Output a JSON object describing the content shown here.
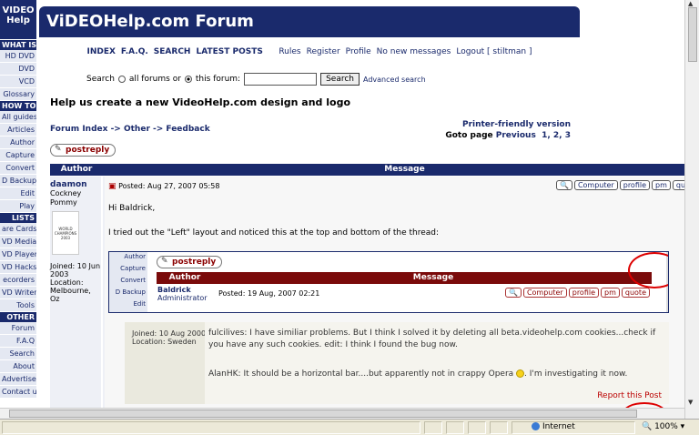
{
  "sidebar": {
    "logo": "VIDEO Help",
    "sections": [
      {
        "title": "WHAT IS",
        "items": [
          "HD DVD",
          "DVD",
          "VCD",
          "Glossary"
        ]
      },
      {
        "title": "HOW TO",
        "items": [
          "All guides",
          "Articles",
          "Author",
          "Capture",
          "Convert",
          "D Backup",
          "Edit",
          "Play"
        ]
      },
      {
        "title": "LISTS",
        "items": [
          "are Cards",
          "VD Media",
          "VD Players",
          "VD Hacks",
          "ecorders",
          "VD Writers",
          "Tools"
        ]
      },
      {
        "title": "OTHER",
        "items": [
          "Forum",
          "F.A.Q",
          "Search",
          "About",
          "Advertise",
          "Contact us"
        ]
      }
    ]
  },
  "header": {
    "title": "ViDEOHelp.com Forum"
  },
  "nav": {
    "primary": [
      "INDEX",
      "F.A.Q.",
      "SEARCH",
      "LATEST POSTS"
    ],
    "secondary": [
      "Rules",
      "Register",
      "Profile",
      "No new messages",
      "Logout [ stiltman ]"
    ]
  },
  "search": {
    "label": "Search",
    "opt_all": "all forums or",
    "opt_this": "this forum:",
    "button": "Search",
    "advanced": "Advanced search"
  },
  "topic": {
    "title": "Help us create a new VideoHelp.com design and logo",
    "breadcrumb": "Forum Index -> Other -> Feedback",
    "printer": "Printer-friendly version",
    "goto_label": "Goto page",
    "goto_prev": "Previous",
    "pages": "1, 2, 3",
    "post_reply": "postreply"
  },
  "table": {
    "col_author": "Author",
    "col_message": "Message"
  },
  "post": {
    "author": "daamon",
    "rank": "Cockney Pommy",
    "badge_text": "WORLD CHAMPIONS 2003",
    "joined": "Joined: 10 Jun 2003",
    "location": "Location: Melbourne, Oz",
    "posted": "Posted: Aug 27, 2007 05:58",
    "buttons": [
      "🔍",
      "Computer",
      "profile",
      "pm",
      "quote"
    ],
    "greeting": "Hi Baldrick,",
    "text": "I tried out the \"Left\" layout and noticed this at the top and bottom of the thread:"
  },
  "screenshot": {
    "side_items": [
      "Author",
      "Capture",
      "Convert",
      "D Backup",
      "Edit"
    ],
    "post_reply": "postreply",
    "col_author": "Author",
    "col_message": "Message",
    "name": "Baldrick",
    "rank": "Administrator",
    "posted": "Posted: 19 Aug, 2007 02:21",
    "buttons": [
      "🔍",
      "Computer",
      "profile",
      "pm",
      "quote"
    ]
  },
  "inner": {
    "joined": "Joined: 10 Aug 2000",
    "location": "Location: Sweden",
    "reply1": "fulcilives: I have similiar problems. But I think I solved it by deleting all beta.videohelp.com cookies...check if you have any such cookies. edit: I think I found the bug now.",
    "reply2_pre": "AlanHK: It should be a horizontal bar....but apparently not in crappy Opera",
    "reply2_post": ". I'm investigating it now.",
    "report": "Report this Post"
  },
  "statusbar": {
    "zone": "Internet",
    "zoom": "100%"
  },
  "colors": {
    "brand": "#1a2a6c",
    "accent": "#7a0a0a",
    "annotation": "#dd0000"
  }
}
